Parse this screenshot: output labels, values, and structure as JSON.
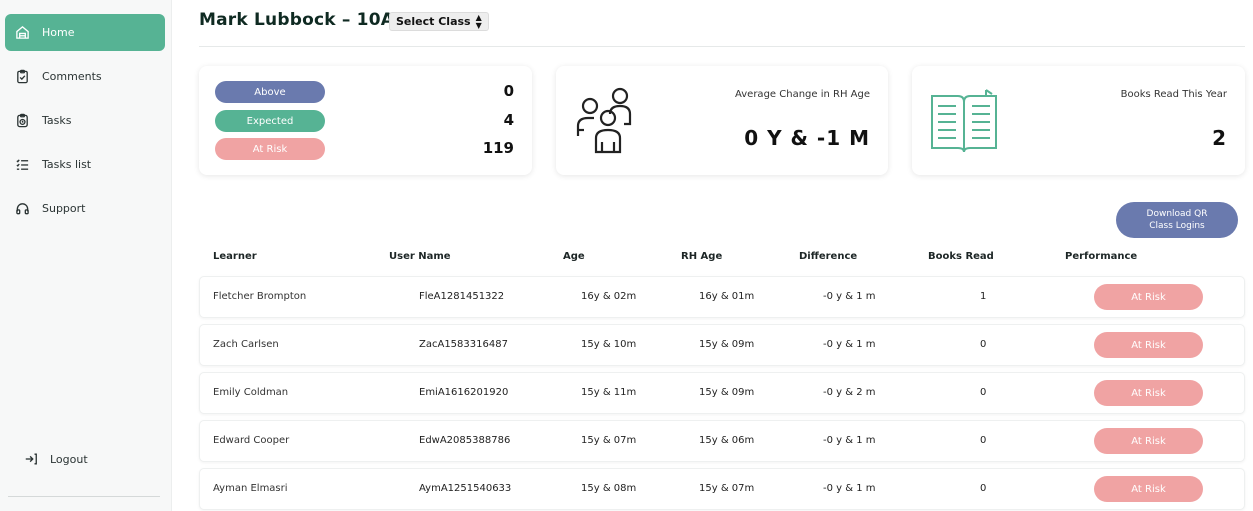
{
  "sidebar": {
    "items": [
      {
        "label": "Home",
        "icon": "home-icon",
        "active": true
      },
      {
        "label": "Comments",
        "icon": "clipboard-check-icon",
        "active": false
      },
      {
        "label": "Tasks",
        "icon": "clipboard-clock-icon",
        "active": false
      },
      {
        "label": "Tasks list",
        "icon": "list-icon",
        "active": false
      },
      {
        "label": "Support",
        "icon": "headphones-icon",
        "active": false
      }
    ],
    "logout_label": "Logout"
  },
  "header": {
    "title": "Mark Lubbock – 10A",
    "select_label": "Select Class"
  },
  "summary": {
    "above_label": "Above",
    "above_count": "0",
    "expected_label": "Expected",
    "expected_count": "4",
    "atrisk_label": "At Risk",
    "atrisk_count": "119"
  },
  "rh_card": {
    "caption": "Average Change in RH Age",
    "value": "0 Y & -1 M",
    "icon": "people-icon"
  },
  "books_card": {
    "caption": "Books Read This Year",
    "value": "2",
    "icon": "book-icon"
  },
  "download": {
    "line1": "Download QR",
    "line2": "Class Logins"
  },
  "table": {
    "headers": [
      "Learner",
      "User Name",
      "Age",
      "RH Age",
      "Difference",
      "Books Read",
      "Performance"
    ],
    "rows": [
      {
        "learner": "Fletcher Brompton",
        "username": "FleA1281451322",
        "age": "16y & 02m",
        "rh_age": "16y & 01m",
        "difference": "-0 y & 1 m",
        "books": "1",
        "performance": "At Risk"
      },
      {
        "learner": "Zach Carlsen",
        "username": "ZacA1583316487",
        "age": "15y & 10m",
        "rh_age": "15y & 09m",
        "difference": "-0 y & 1 m",
        "books": "0",
        "performance": "At Risk"
      },
      {
        "learner": "Emily Coldman",
        "username": "EmiA1616201920",
        "age": "15y & 11m",
        "rh_age": "15y & 09m",
        "difference": "-0 y & 2 m",
        "books": "0",
        "performance": "At Risk"
      },
      {
        "learner": "Edward Cooper",
        "username": "EdwA2085388786",
        "age": "15y & 07m",
        "rh_age": "15y & 06m",
        "difference": "-0 y & 1 m",
        "books": "0",
        "performance": "At Risk"
      },
      {
        "learner": "Ayman Elmasri",
        "username": "AymA1251540633",
        "age": "15y & 08m",
        "rh_age": "15y & 07m",
        "difference": "-0 y & 1 m",
        "books": "0",
        "performance": "At Risk"
      }
    ]
  },
  "colors": {
    "accent": "#56b394",
    "above": "#6a7aae",
    "expected": "#56b394",
    "at_risk": "#f0a3a3",
    "button": "#6a7aae"
  }
}
